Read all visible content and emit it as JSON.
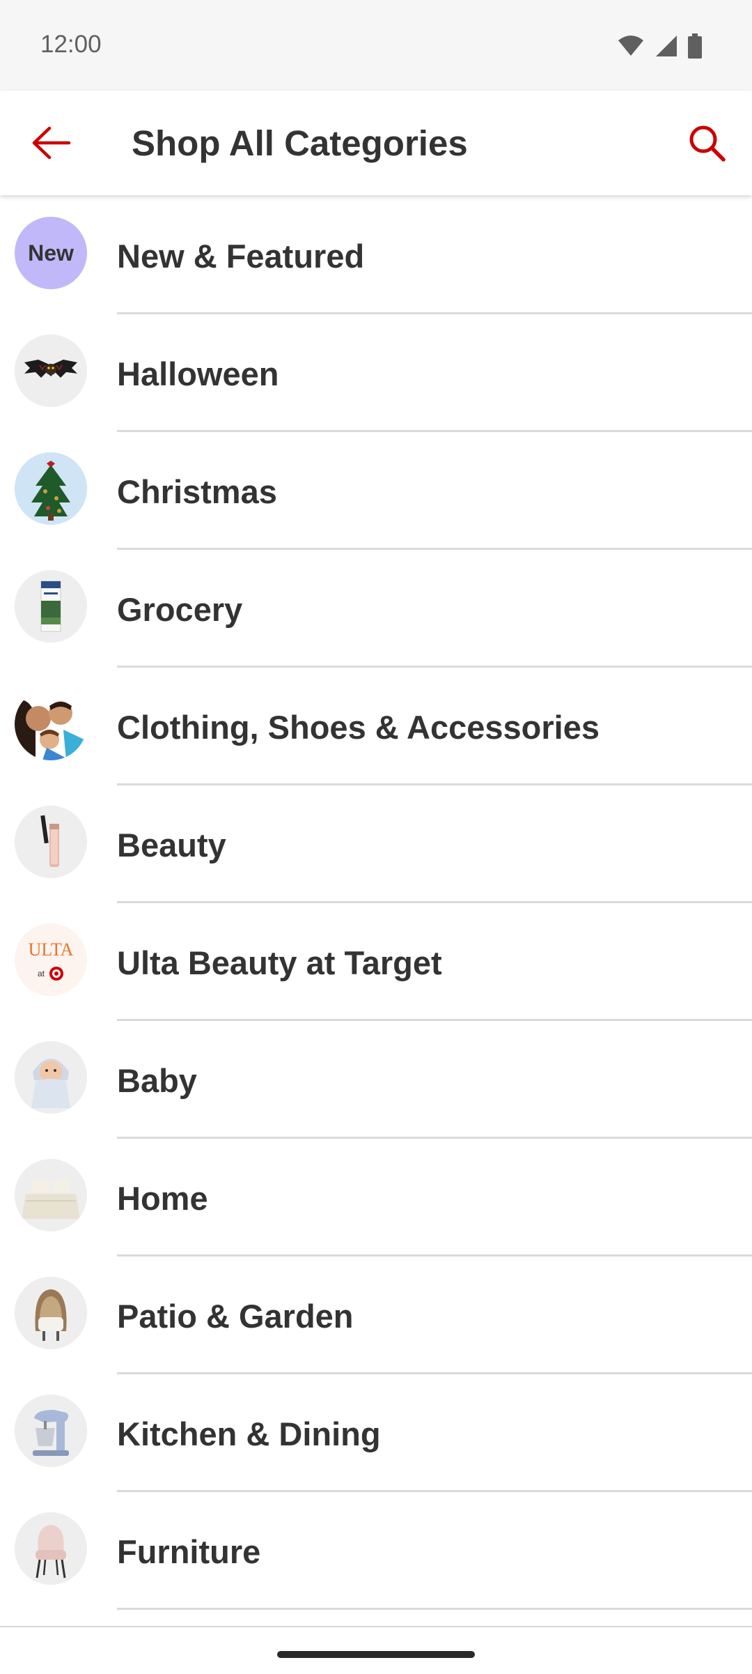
{
  "status_bar": {
    "time": "12:00",
    "icons": [
      "wifi-icon",
      "signal-icon",
      "battery-icon"
    ]
  },
  "app_bar": {
    "title": "Shop All Categories",
    "back_icon": "arrow-left-icon",
    "search_icon": "search-icon"
  },
  "colors": {
    "accent": "#cc0000",
    "text": "#333333",
    "new_badge": "#c0b8f8",
    "divider": "#dadada"
  },
  "categories": [
    {
      "label": "New & Featured",
      "thumb": "new-badge",
      "badge_text": "New"
    },
    {
      "label": "Halloween",
      "thumb": "bat-decoration-image"
    },
    {
      "label": "Christmas",
      "thumb": "christmas-tree-image"
    },
    {
      "label": "Grocery",
      "thumb": "milk-carton-image"
    },
    {
      "label": "Clothing, Shoes & Accessories",
      "thumb": "family-photo-image"
    },
    {
      "label": "Beauty",
      "thumb": "mascara-image"
    },
    {
      "label": "Ulta Beauty at Target",
      "thumb": "ulta-logo-image",
      "logo_text": "ULTA",
      "logo_sub": "at"
    },
    {
      "label": "Baby",
      "thumb": "baby-photo-image"
    },
    {
      "label": "Home",
      "thumb": "bedding-image"
    },
    {
      "label": "Patio & Garden",
      "thumb": "egg-chair-image"
    },
    {
      "label": "Kitchen & Dining",
      "thumb": "stand-mixer-image"
    },
    {
      "label": "Furniture",
      "thumb": "pink-chair-image"
    }
  ]
}
